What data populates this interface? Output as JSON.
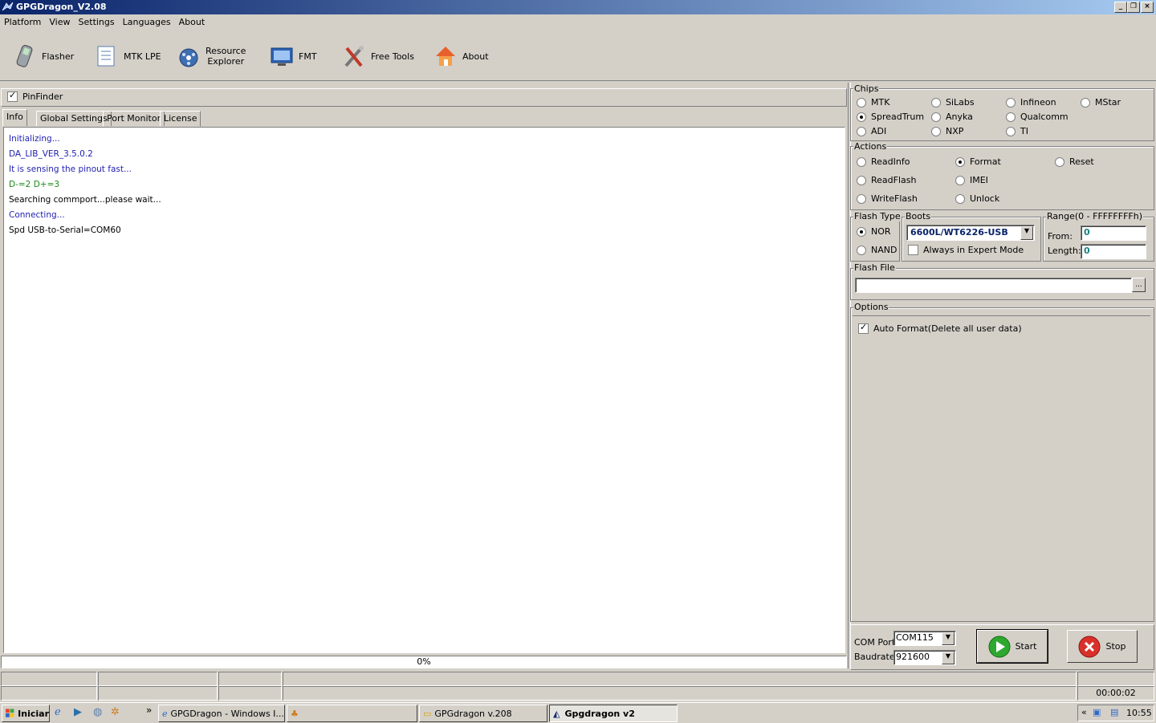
{
  "window": {
    "title": "GPGDragon_V2.08"
  },
  "menu": [
    "Platform",
    "View",
    "Settings",
    "Languages",
    "About"
  ],
  "toolbar": {
    "flasher": "Flasher",
    "mtk_lpe": "MTK LPE",
    "resource_explorer_1": "Resource",
    "resource_explorer_2": "Explorer",
    "fmt": "FMT",
    "free_tools": "Free Tools",
    "about": "About"
  },
  "pinfinder": {
    "label": "PinFinder",
    "checked": true
  },
  "tabs": [
    "Info",
    "Global Settings",
    "Port Monitor",
    "License"
  ],
  "log": [
    {
      "text": "Initializing...",
      "color": "#1f1fb0"
    },
    {
      "text": "DA_LIB_VER_3.5.0.2",
      "color": "#1f1fb0"
    },
    {
      "text": "It is sensing the pinout fast...",
      "color": "#1f1fb0"
    },
    {
      "text": "D-=2  D+=3",
      "color": "#1a8a1a"
    },
    {
      "text": "Searching commport...please wait...",
      "color": "#000000"
    },
    {
      "text": "Connecting...",
      "color": "#1f1fb0"
    },
    {
      "text": "Spd USB-to-Serial=COM60",
      "color": "#000000"
    }
  ],
  "progress": {
    "value": 0,
    "label": "0%"
  },
  "chips": {
    "label": "Chips",
    "items": [
      "MTK",
      "SiLabs",
      "Infineon",
      "MStar",
      "SpreadTrum",
      "Anyka",
      "Qualcomm",
      "ADI",
      "NXP",
      "TI"
    ],
    "selected": "SpreadTrum"
  },
  "actions": {
    "label": "Actions",
    "items": [
      "ReadInfo",
      "Format",
      "Reset",
      "ReadFlash",
      "IMEI",
      "WriteFlash",
      "Unlock"
    ],
    "selected": "Format"
  },
  "flash_type": {
    "label": "Flash Type",
    "nor": "NOR",
    "nand": "NAND",
    "selected": "NOR"
  },
  "boots": {
    "label": "Boots",
    "value": "6600L/WT6226-USB",
    "expert_label": "Always in Expert Mode",
    "expert_checked": false
  },
  "range": {
    "label": "Range(0 - FFFFFFFFh)",
    "from_label": "From:",
    "from_value": "0",
    "length_label": "Length:",
    "length_value": "0"
  },
  "flash_file": {
    "label": "Flash File",
    "value": "",
    "browse": "..."
  },
  "options": {
    "label": "Options",
    "auto_format": "Auto Format(Delete all user data)",
    "auto_format_checked": true
  },
  "com": {
    "port_label": "COM Port",
    "port_value": "COM115",
    "baud_label": "Baudrate",
    "baud_value": "921600"
  },
  "buttons": {
    "start": "Start",
    "stop": "Stop"
  },
  "status": {
    "timer": "00:00:02"
  },
  "taskbar": {
    "start": "Iniciar",
    "tasks": [
      "GPGDragon - Windows I...",
      "",
      "GPGdragon v.208",
      "Gpgdragon v2"
    ],
    "clock": "10:55",
    "chevron": "«"
  }
}
